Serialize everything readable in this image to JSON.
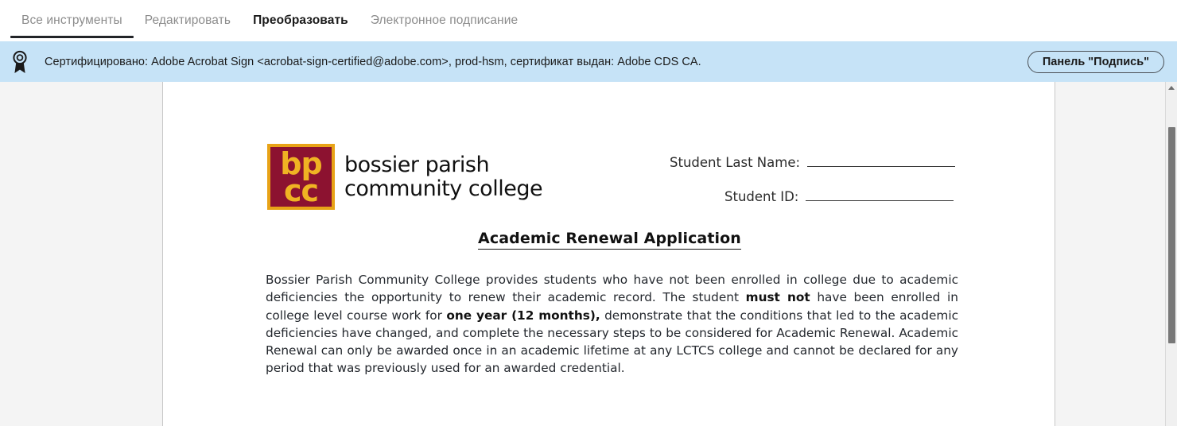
{
  "tabs": [
    {
      "label": "Все инструменты",
      "active": true,
      "bold": false
    },
    {
      "label": "Редактировать",
      "active": false,
      "bold": false
    },
    {
      "label": "Преобразовать",
      "active": false,
      "bold": true
    },
    {
      "label": "Электронное подписание",
      "active": false,
      "bold": false
    }
  ],
  "certification": {
    "icon": "certificate-ribbon-icon",
    "text": "Сертифицировано: Adobe Acrobat Sign <acrobat-sign-certified@adobe.com>, prod-hsm, сертификат выдан: Adobe CDS CA.",
    "button_label": "Панель \"Подпись\"",
    "background_color": "#c6e3f7"
  },
  "toolpanel": {
    "drag_handle": "drag-handle",
    "select_tool": "selection-cursor-icon",
    "select_tool_color": "#1473e6",
    "more_tools": "..."
  },
  "document": {
    "logo": {
      "mark_top": "bp",
      "mark_bottom": "cc",
      "words_line1": "bossier parish",
      "words_line2": "community college",
      "square_color": "#8c1230",
      "border_color": "#e8a317",
      "letter_color": "#f0b323"
    },
    "fields": [
      {
        "label": "Student Last Name:",
        "value": ""
      },
      {
        "label": "Student ID:",
        "value": ""
      }
    ],
    "title": "Academic Renewal Application",
    "paragraph_html": "Bossier Parish Community College provides students who have not been enrolled in college due to academic deficiencies the opportunity to renew their academic record. The student <b>must not</b> have been enrolled in college level course work for <b>one year (12 months),</b> demonstrate that the conditions that led to the academic deficiencies have changed, and complete the necessary steps to be considered for Academic Renewal. Academic Renewal can only be awarded once in an academic lifetime at any LCTCS college and cannot be declared for any period that was previously used for an awarded credential."
  },
  "scrollbar": {
    "up_arrow": "scroll-up-arrow-icon",
    "thumb": "scroll-thumb"
  }
}
